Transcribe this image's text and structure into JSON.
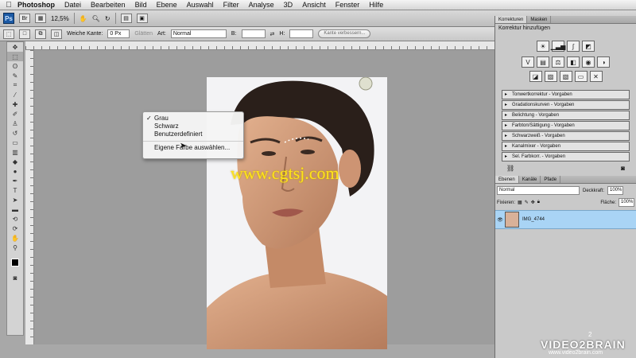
{
  "menubar": {
    "apple": "",
    "app": "Photoshop",
    "items": [
      "Datei",
      "Bearbeiten",
      "Bild",
      "Ebene",
      "Auswahl",
      "Filter",
      "Analyse",
      "3D",
      "Ansicht",
      "Fenster",
      "Hilfe"
    ]
  },
  "appbar": {
    "ps": "Ps",
    "zoom": "12,5%"
  },
  "options": {
    "feather_label": "Weiche Kante:",
    "feather_value": "0 Px",
    "antialias_label": "Glätten",
    "style_label": "Art:",
    "style_value": "Normal",
    "width_label": "B:",
    "height_label": "H:",
    "refine_button": "Kante verbessern..."
  },
  "context_menu": {
    "items": [
      "Grau",
      "Schwarz",
      "Benutzerdefiniert"
    ],
    "checked": "Grau",
    "custom_color": "Eigene Farbe auswählen..."
  },
  "watermark": "www.cgtsj.com",
  "adjustments_panel": {
    "tabs": [
      "Korrekturen",
      "Masken"
    ],
    "title": "Korrektur hinzufügen",
    "presets": [
      "Tonwertkorrektur - Vorgaben",
      "Gradationskurven - Vorgaben",
      "Belichtung - Vorgaben",
      "Farbton/Sättigung - Vorgaben",
      "Schwarzweiß - Vorgaben",
      "Kanalmixer - Vorgaben",
      "Sel. Farbkorr. - Vorgaben"
    ]
  },
  "layers_panel": {
    "tabs": [
      "Ebenen",
      "Kanäle",
      "Pfade"
    ],
    "blend_mode": "Normal",
    "opacity_label": "Deckkraft:",
    "opacity_value": "100%",
    "lock_label": "Fixieren:",
    "fill_label": "Fläche:",
    "fill_value": "100%",
    "layer_name": "IMG_4744"
  },
  "brand": {
    "name": "VIDEO2BRAIN",
    "url": "www.video2brain.com",
    "number": "2"
  },
  "colors": {
    "accent": "#1c5aa5",
    "layer_selected": "#a9d4f5",
    "watermark": "#ffe41a"
  }
}
